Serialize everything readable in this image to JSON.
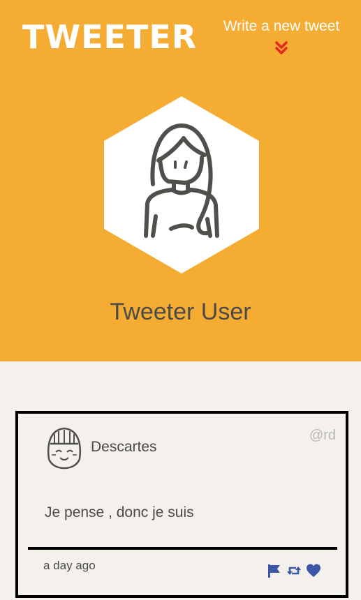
{
  "app": {
    "logo_text": "TWEETER",
    "compose_label": "Write a new tweet",
    "compose_icon": "chevron-double-down-icon",
    "accent_color": "#f5ac33",
    "icon_accent_color": "#e8251e"
  },
  "profile": {
    "name": "Tweeter User",
    "avatar_icon": "user-avatar-icon"
  },
  "tweets": [
    {
      "author": "Descartes",
      "handle": "@rd",
      "text": "Je pense , donc je suis",
      "time": "a day ago",
      "actions": [
        "flag-icon",
        "retweet-icon",
        "heart-icon"
      ],
      "action_color": "#3c56a8"
    }
  ]
}
